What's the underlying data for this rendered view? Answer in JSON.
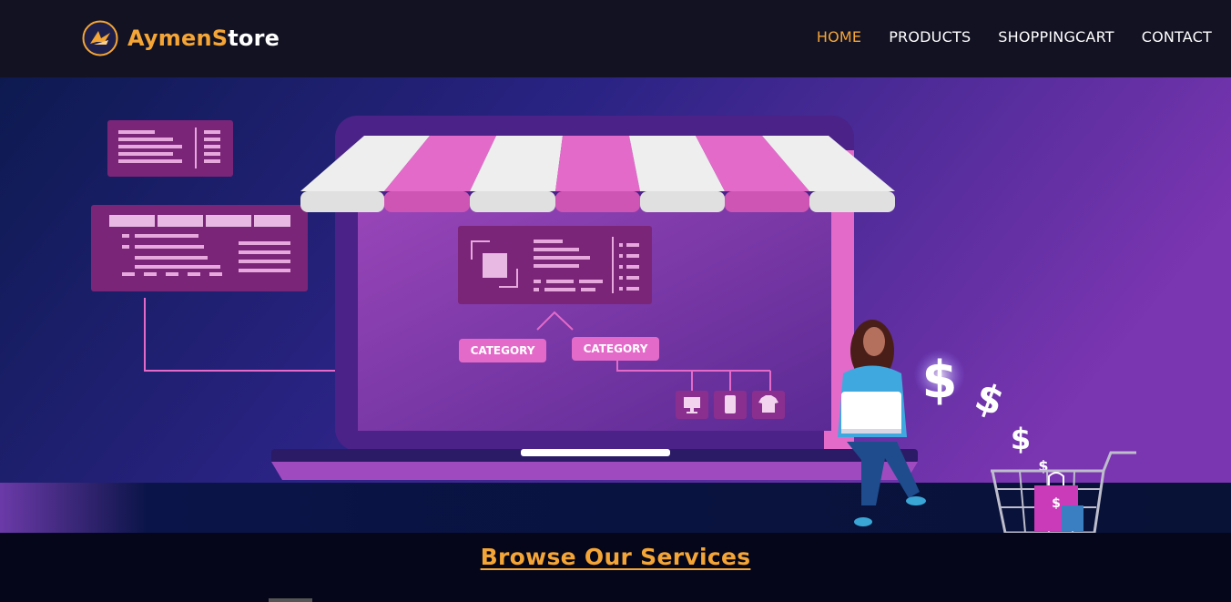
{
  "brand": {
    "name_part1": "Aymen",
    "name_part2": "S",
    "name_part3": "tore",
    "logo_icon": "bird-logo-icon"
  },
  "nav": {
    "items": [
      {
        "label": "HOME",
        "active": true
      },
      {
        "label": "PRODUCTS",
        "active": false
      },
      {
        "label": "SHOPPINGCART",
        "active": false
      },
      {
        "label": "CONTACT",
        "active": false
      }
    ]
  },
  "hero": {
    "category_1": "CATEGORY",
    "category_2": "CATEGORY",
    "currency_symbol": "$"
  },
  "cta": {
    "label": "Browse Our Services"
  },
  "colors": {
    "navbar_bg": "#131223",
    "accent": "#f4a536",
    "hero_dark": "#0f1a52",
    "hero_purple": "#7a35b0",
    "pink": "#e46ac9"
  }
}
